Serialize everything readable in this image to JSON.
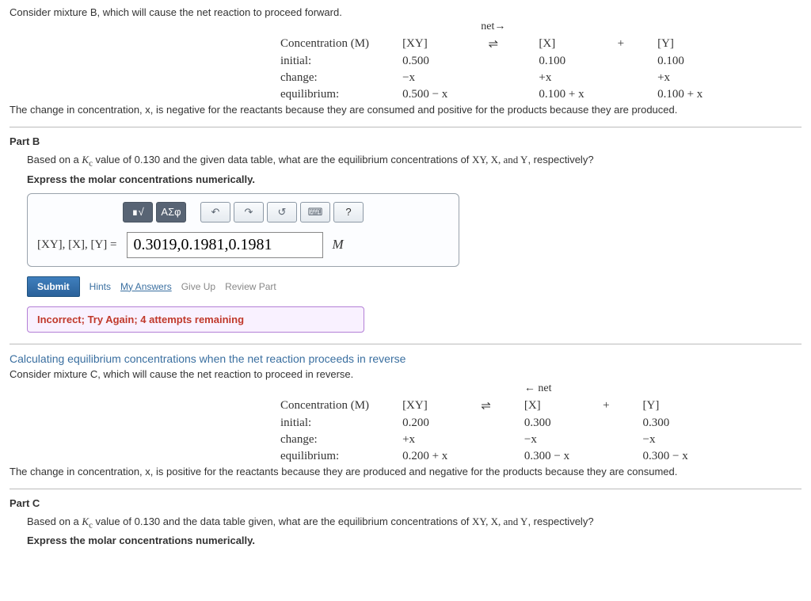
{
  "intro_b": "Consider mixture B, which will cause the net reaction to proceed forward.",
  "net_forward": "net→",
  "net_reverse": "← net",
  "ice": {
    "header_conc": "Concentration (M)",
    "col_xy": "[XY]",
    "col_eq": "⇌",
    "col_x": "[X]",
    "col_plus": "+",
    "col_y": "[Y]",
    "row_initial": "initial:",
    "row_change": "change:",
    "row_eq": "equilibrium:"
  },
  "ice_b": {
    "initial_xy": "0.500",
    "initial_x": "0.100",
    "initial_y": "0.100",
    "change_xy": "−x",
    "change_x": "+x",
    "change_y": "+x",
    "eq_xy": "0.500 − x",
    "eq_x": "0.100 + x",
    "eq_y": "0.100 + x"
  },
  "note_b": "The change in concentration, x, is negative for the reactants because they are consumed and positive for the products because they are produced.",
  "partB": {
    "heading": "Part B",
    "question_pre": "Based on a ",
    "kc_label": "Kc",
    "question_mid": " value of 0.130 and the given data table, what are the equilibrium concentrations of ",
    "species": "XY, X, and Y",
    "question_post": ", respectively?",
    "instruction": "Express the molar concentrations numerically.",
    "answer_label": "[XY], [X], [Y] =",
    "answer_value": "0.3019,0.1981,0.1981",
    "unit": "M",
    "toolbar": {
      "templates": "∎√",
      "greek": "ΑΣφ",
      "undo": "↶",
      "redo": "↷",
      "reset": "↺",
      "keyboard": "⌨",
      "help": "?"
    },
    "submit": "Submit",
    "hints": "Hints",
    "my_answers": "My Answers",
    "give_up": "Give Up",
    "review": "Review Part",
    "feedback": "Incorrect; Try Again; 4 attempts remaining"
  },
  "section_reverse": {
    "heading": "Calculating equilibrium concentrations when the net reaction proceeds in reverse",
    "intro": "Consider mixture C, which will cause the net reaction to proceed in reverse."
  },
  "ice_c": {
    "initial_xy": "0.200",
    "initial_x": "0.300",
    "initial_y": "0.300",
    "change_xy": "+x",
    "change_x": "−x",
    "change_y": "−x",
    "eq_xy": "0.200 + x",
    "eq_x": "0.300 − x",
    "eq_y": "0.300 − x"
  },
  "note_c": "The change in concentration, x, is positive for the reactants because they are produced and negative for the products because they are consumed.",
  "partC": {
    "heading": "Part C",
    "question_pre": "Based on a ",
    "question_mid": " value of 0.130 and the data table given, what are the equilibrium concentrations of ",
    "species": "XY, X, and Y",
    "question_post": ", respectively?",
    "instruction": "Express the molar concentrations numerically."
  }
}
